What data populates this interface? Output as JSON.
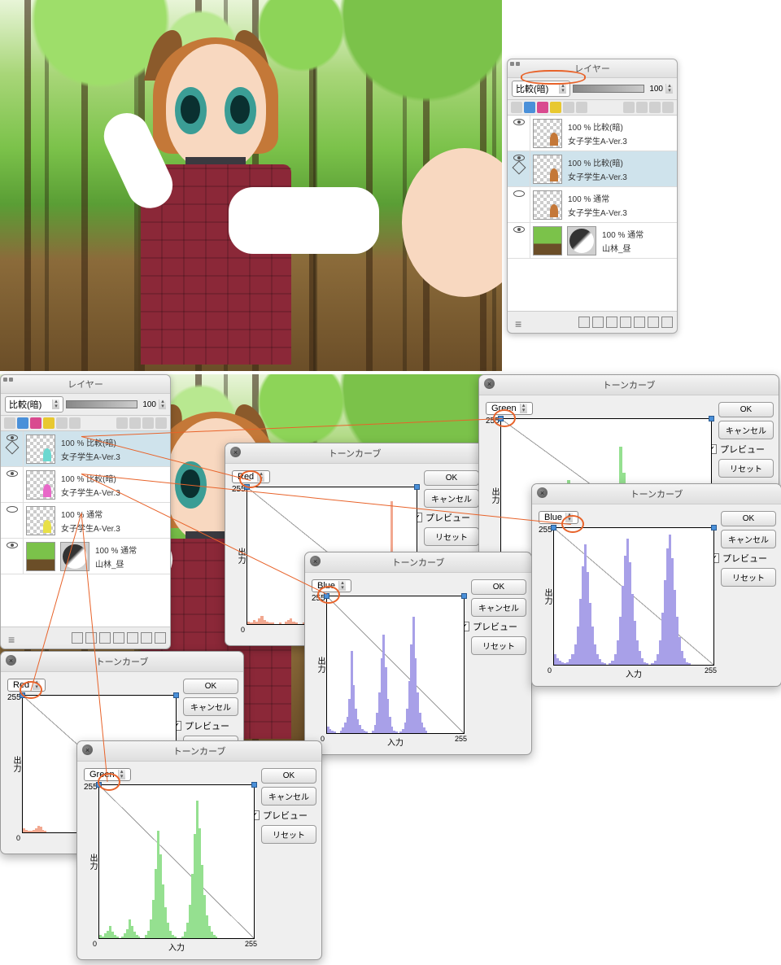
{
  "panels": {
    "layer_panel": {
      "title": "レイヤー",
      "blend_mode": "比較(暗)",
      "opacity": "100",
      "layers_a": [
        {
          "mode": "100 % 比較(暗)",
          "name": "女子学生A-Ver.3",
          "sel": false
        },
        {
          "mode": "100 % 比較(暗)",
          "name": "女子学生A-Ver.3",
          "sel": true
        },
        {
          "mode": "100 % 通常",
          "name": "女子学生A-Ver.3",
          "sel": false
        },
        {
          "mode": "100 % 通常",
          "name": "山林_昼",
          "sel": false
        }
      ],
      "layers_b": [
        {
          "mode": "100 % 比較(暗)",
          "name": "女子学生A-Ver.3",
          "sel": true
        },
        {
          "mode": "100 % 比較(暗)",
          "name": "女子学生A-Ver.3",
          "sel": false
        },
        {
          "mode": "100 % 通常",
          "name": "女子学生A-Ver.3",
          "sel": false
        },
        {
          "mode": "100 % 通常",
          "name": "山林_昼",
          "sel": false
        }
      ]
    }
  },
  "tone": {
    "title": "トーンカーブ",
    "ok": "OK",
    "cancel": "キャンセル",
    "preview": "プレビュー",
    "reset": "リセット",
    "axis_in": "入力",
    "axis_out": "出力",
    "axis_min": "0",
    "axis_max": "255",
    "point_val": "255"
  },
  "channels": {
    "red": "Red",
    "green": "Green",
    "blue": "Blue"
  },
  "chart_data": [
    {
      "type": "area",
      "title": "トーンカーブ",
      "channel": "Red",
      "xlabel": "入力",
      "ylabel": "出力",
      "xlim": [
        0,
        255
      ],
      "ylim": [
        0,
        255
      ],
      "curve_points": [
        [
          0,
          255
        ],
        [
          255,
          255
        ]
      ],
      "histogram": [
        2,
        1,
        3,
        2,
        4,
        6,
        3,
        2,
        1,
        1,
        0,
        0,
        1,
        0,
        2,
        3,
        4,
        2,
        1,
        0,
        0,
        1,
        2,
        3,
        5,
        8,
        6,
        4,
        2,
        1,
        0,
        1,
        0,
        0,
        0,
        0,
        0,
        0,
        0,
        0,
        0,
        0,
        0,
        0,
        0,
        0,
        0,
        0,
        0,
        0,
        0,
        1,
        0,
        0,
        90,
        10,
        2,
        0,
        0,
        0,
        0,
        0,
        0,
        0
      ],
      "color": "#f2a890"
    },
    {
      "type": "area",
      "title": "トーンカーブ",
      "channel": "Blue",
      "xlabel": "入力",
      "ylabel": "出力",
      "xlim": [
        0,
        255
      ],
      "ylim": [
        0,
        255
      ],
      "curve_points": [
        [
          0,
          255
        ],
        [
          255,
          255
        ]
      ],
      "histogram": [
        5,
        3,
        2,
        1,
        0,
        0,
        2,
        4,
        8,
        12,
        25,
        60,
        35,
        18,
        10,
        6,
        3,
        2,
        1,
        0,
        0,
        2,
        6,
        15,
        30,
        55,
        72,
        48,
        25,
        12,
        5,
        2,
        1,
        0,
        1,
        3,
        8,
        18,
        38,
        65,
        85,
        55,
        30,
        15,
        8,
        4,
        2,
        0,
        0,
        0,
        0,
        0,
        0,
        0,
        0,
        0,
        0,
        0,
        0,
        0,
        0,
        0,
        0,
        0
      ],
      "color": "#a8a0e8"
    },
    {
      "type": "area",
      "title": "トーンカーブ",
      "channel": "Green",
      "xlabel": "入力",
      "ylabel": "出力",
      "xlim": [
        0,
        255
      ],
      "ylim": [
        0,
        255
      ],
      "curve_points": [
        [
          0,
          255
        ],
        [
          255,
          255
        ]
      ],
      "histogram": [
        2,
        1,
        3,
        5,
        8,
        4,
        2,
        1,
        0,
        1,
        3,
        6,
        12,
        8,
        4,
        2,
        1,
        0,
        0,
        2,
        5,
        12,
        25,
        45,
        70,
        55,
        35,
        20,
        10,
        5,
        2,
        1,
        0,
        0,
        1,
        4,
        10,
        22,
        42,
        68,
        90,
        72,
        48,
        28,
        15,
        8,
        4,
        2,
        1,
        0,
        0,
        0,
        0,
        0,
        0,
        0,
        0,
        0,
        0,
        0,
        0,
        0,
        0,
        0
      ],
      "color": "#95e090"
    },
    {
      "type": "area",
      "title": "トーンカーブ",
      "channel": "Red",
      "xlabel": "入力",
      "ylabel": "出力",
      "xlim": [
        0,
        255
      ],
      "ylim": [
        0,
        255
      ],
      "curve_points": [
        [
          0,
          255
        ],
        [
          255,
          255
        ]
      ],
      "histogram": [
        3,
        2,
        1,
        1,
        2,
        3,
        5,
        4,
        2,
        1,
        0,
        0,
        0,
        0,
        0,
        0,
        0,
        0,
        0,
        0,
        0,
        0,
        0,
        0,
        0,
        0,
        0,
        0,
        0,
        0,
        0,
        0,
        0,
        0,
        0,
        0,
        0,
        0,
        0,
        0,
        0,
        0,
        0,
        0,
        1,
        2,
        1,
        0,
        0,
        0,
        0,
        0,
        0,
        0,
        0,
        0,
        0,
        0,
        0,
        0,
        0,
        0,
        0,
        0
      ],
      "color": "#f2a890"
    },
    {
      "type": "area",
      "title": "トーンカーブ",
      "channel": "Green",
      "xlabel": "入力",
      "ylabel": "出力",
      "xlim": [
        0,
        255
      ],
      "ylim": [
        0,
        255
      ],
      "histogram": [
        2,
        1,
        0,
        0,
        0,
        0,
        1,
        2,
        4,
        3,
        2,
        1,
        0,
        0,
        1,
        3,
        6,
        12,
        22,
        40,
        60,
        45,
        28,
        15,
        8,
        4,
        2,
        1,
        0,
        0,
        1,
        3,
        8,
        18,
        35,
        58,
        82,
        65,
        42,
        25,
        12,
        6,
        3,
        1,
        0,
        0,
        0,
        0,
        0,
        0,
        0,
        0,
        0,
        0,
        0,
        0,
        0,
        0,
        0,
        0,
        0,
        0,
        0,
        0
      ],
      "color": "#95e090"
    },
    {
      "type": "area",
      "title": "トーンカーブ",
      "channel": "Blue",
      "xlabel": "入力",
      "ylabel": "出力",
      "xlim": [
        0,
        255
      ],
      "ylim": [
        0,
        255
      ],
      "histogram": [
        8,
        5,
        3,
        2,
        1,
        2,
        4,
        8,
        15,
        28,
        48,
        72,
        88,
        68,
        45,
        28,
        15,
        8,
        4,
        2,
        1,
        0,
        1,
        3,
        8,
        18,
        35,
        58,
        80,
        92,
        75,
        52,
        32,
        18,
        10,
        5,
        2,
        1,
        0,
        1,
        3,
        8,
        18,
        38,
        62,
        85,
        95,
        78,
        55,
        35,
        20,
        10,
        5,
        2,
        1,
        0,
        0,
        0,
        0,
        0,
        0,
        0,
        0,
        0
      ],
      "color": "#a8a0e8"
    }
  ]
}
